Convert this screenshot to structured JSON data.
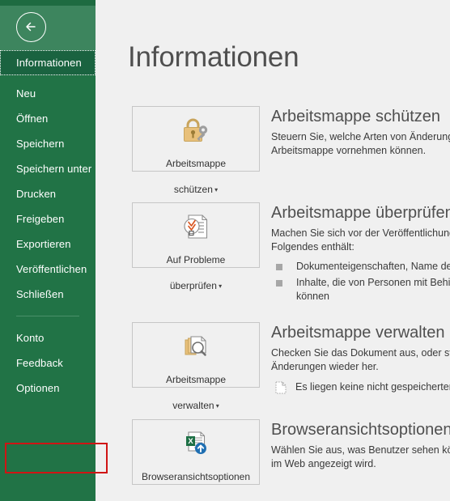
{
  "window": {
    "accent_green": "#217346",
    "accent_green_light": "#3d855e",
    "highlight_red": "#d01414",
    "page_background": "#f0f0f0"
  },
  "sidebar": {
    "back_button": {
      "name": "back-arrow",
      "label": "Zurück"
    },
    "items": [
      {
        "label": "Informationen",
        "selected": true
      },
      {
        "label": "Neu",
        "selected": false
      },
      {
        "label": "Öffnen",
        "selected": false
      },
      {
        "label": "Speichern",
        "selected": false
      },
      {
        "label": "Speichern unter",
        "selected": false
      },
      {
        "label": "Drucken",
        "selected": false
      },
      {
        "label": "Freigeben",
        "selected": false
      },
      {
        "label": "Exportieren",
        "selected": false
      },
      {
        "label": "Veröffentlichen",
        "selected": false
      },
      {
        "label": "Schließen",
        "selected": false
      }
    ],
    "items_after_separator": [
      {
        "label": "Konto",
        "selected": false
      },
      {
        "label": "Feedback",
        "selected": false
      },
      {
        "label": "Optionen",
        "selected": false,
        "highlighted": true
      }
    ]
  },
  "main": {
    "title": "Informationen",
    "sections": [
      {
        "id": "protect-workbook",
        "button": {
          "icon": "lock-key-icon",
          "label_line1": "Arbeitsmappe",
          "label_line2": "schützen",
          "has_dropdown": true
        },
        "heading": "Arbeitsmappe schützen",
        "body_lines": [
          "Steuern Sie, welche Arten von Änderunge",
          "Arbeitsmappe vornehmen können."
        ]
      },
      {
        "id": "inspect-workbook",
        "button": {
          "icon": "inspect-document-icon",
          "label_line1": "Auf Probleme",
          "label_line2": "überprüfen",
          "has_dropdown": true
        },
        "heading": "Arbeitsmappe überprüfen",
        "body_lines": [
          "Machen Sie sich vor der Veröffentlichung",
          "Folgendes enthält:"
        ],
        "bullets": [
          "Dokumenteigenschaften, Name des A",
          "Inhalte, die von Personen mit Behind\nkönnen"
        ]
      },
      {
        "id": "manage-workbook",
        "button": {
          "icon": "manage-versions-icon",
          "label_line1": "Arbeitsmappe",
          "label_line2": "verwalten",
          "has_dropdown": true
        },
        "heading": "Arbeitsmappe verwalten",
        "body_lines": [
          "Checken Sie das Dokument aus, oder stell",
          "Änderungen wieder her."
        ],
        "note": {
          "icon": "unsaved-document-icon",
          "text": "Es liegen keine nicht gespeicherten Ä"
        }
      },
      {
        "id": "browser-view-options",
        "button": {
          "icon": "browser-view-icon",
          "label_line1": "Browseransichtsoptionen",
          "label_line2": "",
          "has_dropdown": false
        },
        "heading": "Browseransichtsoptionen",
        "body_lines": [
          "Wählen Sie aus, was Benutzer sehen könn",
          "im Web angezeigt wird."
        ]
      }
    ]
  }
}
